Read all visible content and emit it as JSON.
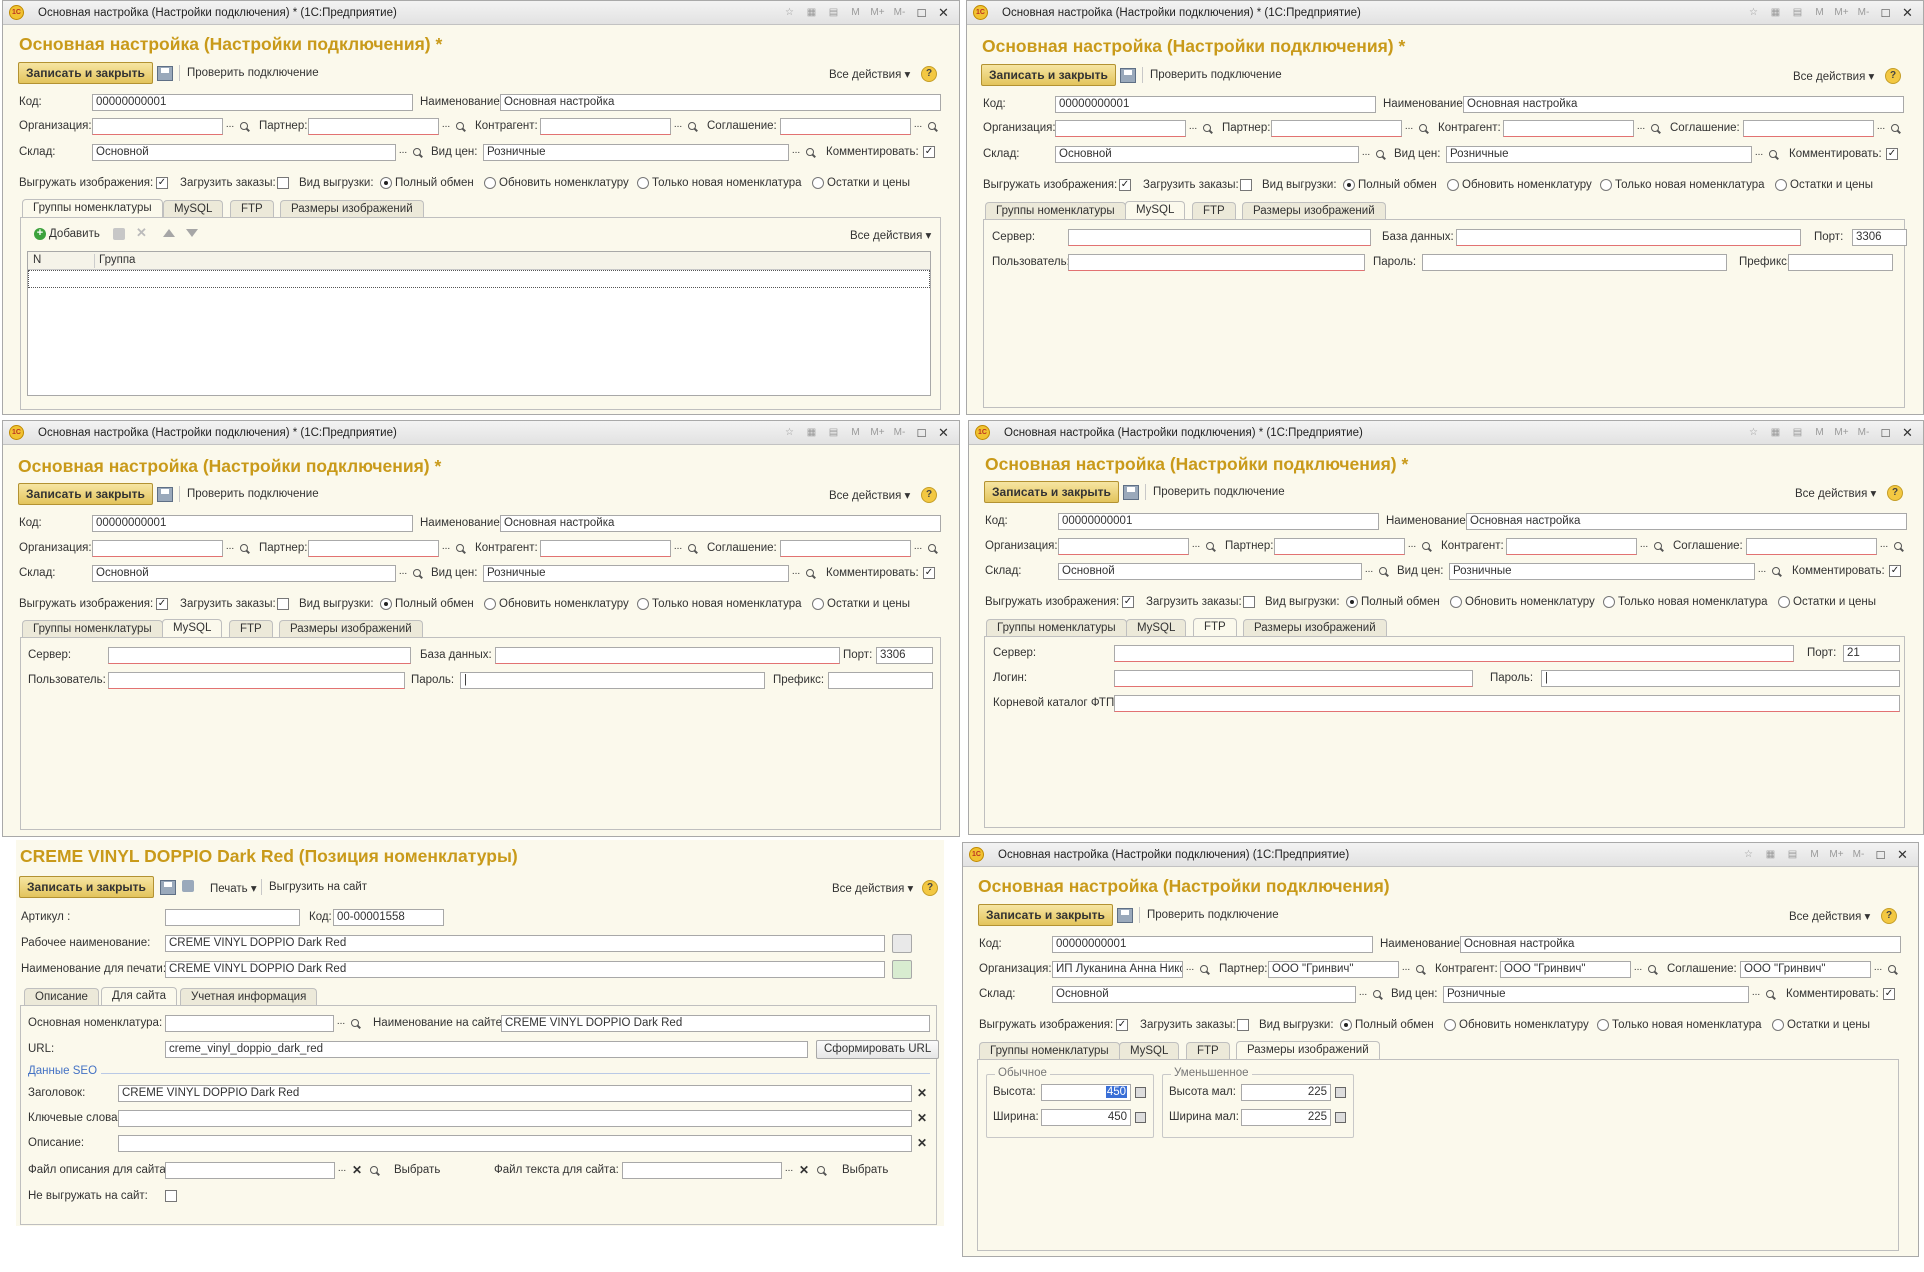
{
  "common": {
    "app_title": "Основная настройка (Настройки подключения) * (1С:Предприятие)",
    "app_title_saved": "Основная настройка (Настройки подключения) (1С:Предприятие)",
    "form_title": "Основная настройка (Настройки подключения) *",
    "form_title_saved": "Основная настройка (Настройки подключения)",
    "logo": "1С",
    "save_close": "Записать и закрыть",
    "check_connection": "Проверить подключение",
    "all_actions": "Все действия ▾",
    "help": "?",
    "title_buttons": [
      "M",
      "M+",
      "M-"
    ],
    "code_label": "Код:",
    "code_value": "00000000001",
    "name_label": "Наименование:",
    "name_value": "Основная настройка",
    "org_label": "Организация:",
    "partner_label": "Партнер:",
    "counterparty_label": "Контрагент:",
    "agreement_label": "Соглашение:",
    "warehouse_label": "Склад:",
    "warehouse_value": "Основной",
    "price_type_label": "Вид цен:",
    "price_type_value": "Розничные",
    "comment_label": "Комментировать:",
    "export_images_label": "Выгружать изображения:",
    "load_orders_label": "Загрузить заказы:",
    "export_type_label": "Вид выгрузки:",
    "radio_full": "Полный обмен",
    "radio_update": "Обновить номенклатуру",
    "radio_new": "Только новая номенклатура",
    "radio_stock": "Остатки и цены",
    "tabs": [
      "Группы номенклатуры",
      "MySQL",
      "FTP",
      "Размеры изображений"
    ],
    "add_label": "Добавить",
    "col_n": "N",
    "col_group": "Группа",
    "server_label": "Сервер:",
    "db_label": "База данных:",
    "port_label": "Порт:",
    "mysql_port": "3306",
    "user_label": "Пользователь:",
    "password_label": "Пароль:",
    "prefix_label": "Префикс:",
    "login_label": "Логин:",
    "ftp_port": "21",
    "ftp_root_label": "Корневой каталог ФТП:"
  },
  "final": {
    "org_value": "ИП Луканина Анна Нико",
    "partner_value": "ООО \"Гринвич\"",
    "counterparty_value": "ООО \"Гринвич\"",
    "agreement_value": "ООО \"Гринвич\"",
    "normal_group": "Обычное",
    "small_group": "Уменьшенное",
    "height_label": "Высота:",
    "width_label": "Ширина:",
    "height_small_label": "Высота мал:",
    "width_small_label": "Ширина мал:",
    "height_value": "450",
    "width_value": "450",
    "height_small_value": "225",
    "width_small_value": "225"
  },
  "item": {
    "title": "CREME VINYL DOPPIO Dark Red (Позиция номенклатуры)",
    "print_label": "Печать ▾",
    "upload_label": "Выгрузить на сайт",
    "article_label": "Артикул :",
    "code_label": "Код:",
    "code_value": "00-00001558",
    "work_name_label": "Рабочее наименование:",
    "work_name_value": "CREME VINYL DOPPIO Dark Red",
    "print_name_label": "Наименование для печати:",
    "print_name_value": "CREME VINYL DOPPIO Dark Red",
    "tabs": [
      "Описание",
      "Для сайта",
      "Учетная информация"
    ],
    "main_nom_label": "Основная номенклатура:",
    "site_name_label": "Наименование на сайте:",
    "site_name_value": "CREME VINYL DOPPIO Dark Red",
    "url_label": "URL:",
    "url_value": "creme_vinyl_doppio_dark_red",
    "make_url": "Сформировать URL",
    "seo_label": "Данные SEO",
    "heading_label": "Заголовок:",
    "heading_value": "CREME VINYL DOPPIO Dark Red",
    "keywords_label": "Ключевые слова:",
    "description_label": "Описание:",
    "desc_file_label": "Файл описания для сайта:",
    "text_file_label": "Файл текста для сайта:",
    "choose": "Выбрать",
    "no_export_label": "Не выгружать на сайт:"
  }
}
